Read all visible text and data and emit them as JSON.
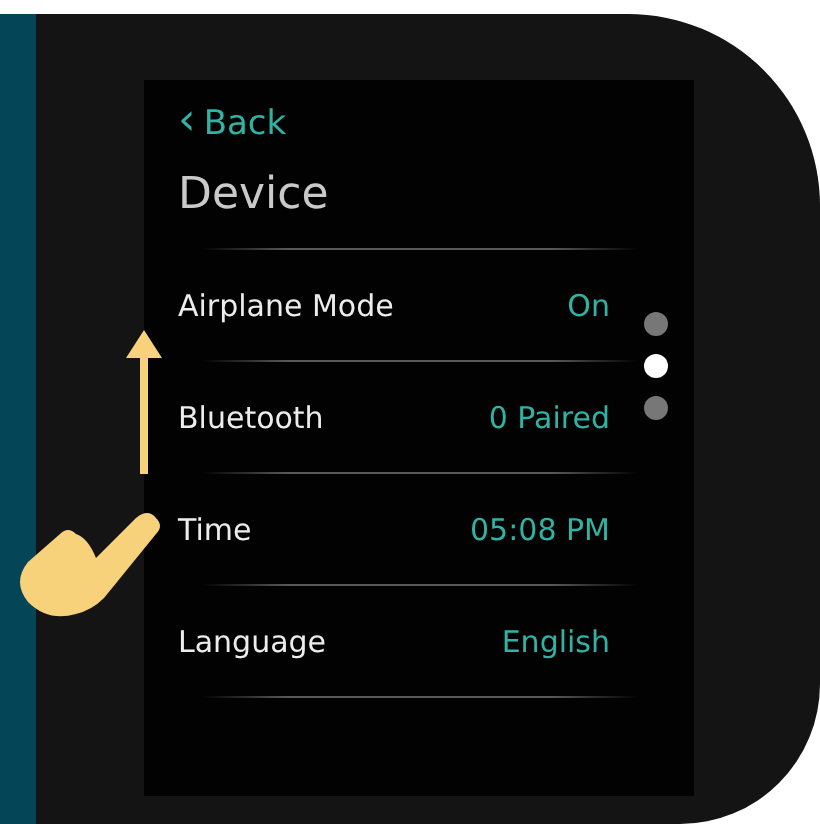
{
  "screen": {
    "back": {
      "icon": "‹",
      "label": "Back"
    },
    "title": "Device",
    "rows": [
      {
        "label": "Airplane Mode",
        "value": "On"
      },
      {
        "label": "Bluetooth",
        "value": "0 Paired"
      },
      {
        "label": "Time",
        "value": "05:08 PM"
      },
      {
        "label": "Language",
        "value": "English"
      }
    ]
  },
  "page_dots": [
    {
      "selected": false
    },
    {
      "selected": true
    },
    {
      "selected": false
    }
  ]
}
